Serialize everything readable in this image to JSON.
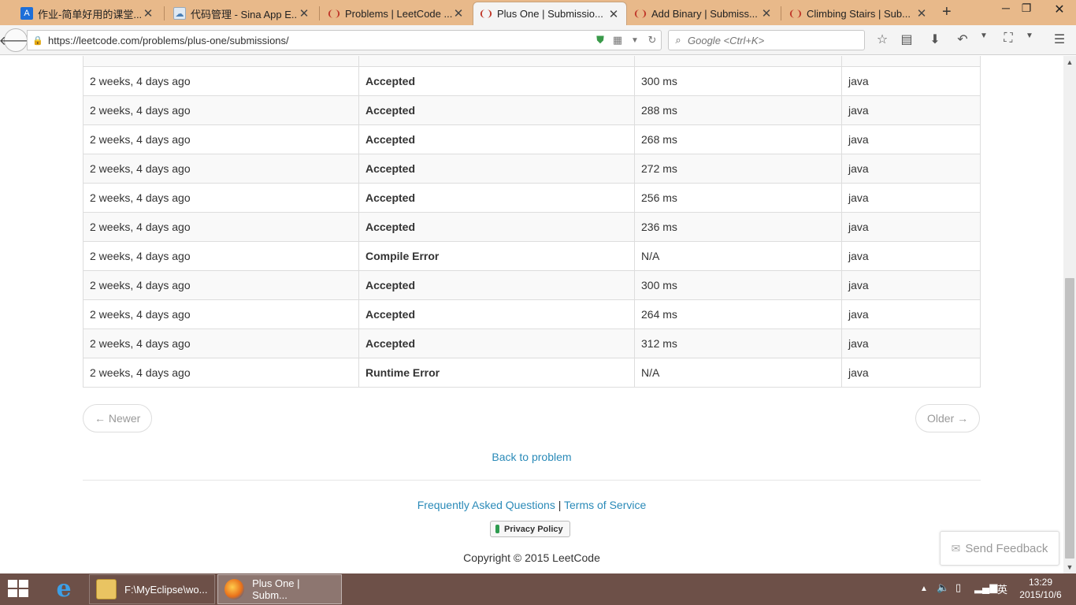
{
  "browser": {
    "tabs": [
      {
        "title": "作业-简单好用的课堂...",
        "favicon": "A+",
        "active": false
      },
      {
        "title": "代码管理 - Sina App E...",
        "favicon": "sina",
        "active": false
      },
      {
        "title": "Problems | LeetCode ...",
        "favicon": "leetcode",
        "active": false
      },
      {
        "title": "Plus One | Submissio...",
        "favicon": "leetcode",
        "active": true
      },
      {
        "title": "Add Binary | Submiss...",
        "favicon": "leetcode",
        "active": false
      },
      {
        "title": "Climbing Stairs | Sub...",
        "favicon": "leetcode",
        "active": false
      }
    ],
    "url": "https://leetcode.com/problems/plus-one/submissions/",
    "search_placeholder": "Google <Ctrl+K>"
  },
  "submissions": {
    "rows": [
      {
        "time": "2 weeks, 4 days ago",
        "status": "Accepted",
        "runtime": "300 ms",
        "language": "java",
        "ok": true
      },
      {
        "time": "2 weeks, 4 days ago",
        "status": "Accepted",
        "runtime": "288 ms",
        "language": "java",
        "ok": true
      },
      {
        "time": "2 weeks, 4 days ago",
        "status": "Accepted",
        "runtime": "268 ms",
        "language": "java",
        "ok": true
      },
      {
        "time": "2 weeks, 4 days ago",
        "status": "Accepted",
        "runtime": "272 ms",
        "language": "java",
        "ok": true
      },
      {
        "time": "2 weeks, 4 days ago",
        "status": "Accepted",
        "runtime": "256 ms",
        "language": "java",
        "ok": true
      },
      {
        "time": "2 weeks, 4 days ago",
        "status": "Accepted",
        "runtime": "236 ms",
        "language": "java",
        "ok": true
      },
      {
        "time": "2 weeks, 4 days ago",
        "status": "Compile Error",
        "runtime": "N/A",
        "language": "java",
        "ok": false
      },
      {
        "time": "2 weeks, 4 days ago",
        "status": "Accepted",
        "runtime": "300 ms",
        "language": "java",
        "ok": true
      },
      {
        "time": "2 weeks, 4 days ago",
        "status": "Accepted",
        "runtime": "264 ms",
        "language": "java",
        "ok": true
      },
      {
        "time": "2 weeks, 4 days ago",
        "status": "Accepted",
        "runtime": "312 ms",
        "language": "java",
        "ok": true
      },
      {
        "time": "2 weeks, 4 days ago",
        "status": "Runtime Error",
        "runtime": "N/A",
        "language": "java",
        "ok": false
      }
    ]
  },
  "pager": {
    "newer": "← Newer",
    "older": "Older →"
  },
  "back_to_problem": "Back to problem",
  "footer": {
    "faq": "Frequently Asked Questions",
    "separator": "|",
    "terms": "Terms of Service",
    "privacy": "Privacy Policy",
    "copyright": "Copyright © 2015 LeetCode"
  },
  "feedback": {
    "label": "Send Feedback"
  },
  "taskbar": {
    "items": [
      {
        "label": "F:\\MyEclipse\\wo...",
        "icon": "folder-icon",
        "active": false
      },
      {
        "label": "Plus One | Subm...",
        "icon": "firefox-icon",
        "active": true
      }
    ],
    "ime": "英",
    "time": "13:29",
    "date": "2015/10/6"
  },
  "colors": {
    "accepted": "#3c763d",
    "error": "#a94442",
    "link": "#2a8ab8",
    "tabstrip": "#e8b98a",
    "taskbar": "#6d5048"
  }
}
